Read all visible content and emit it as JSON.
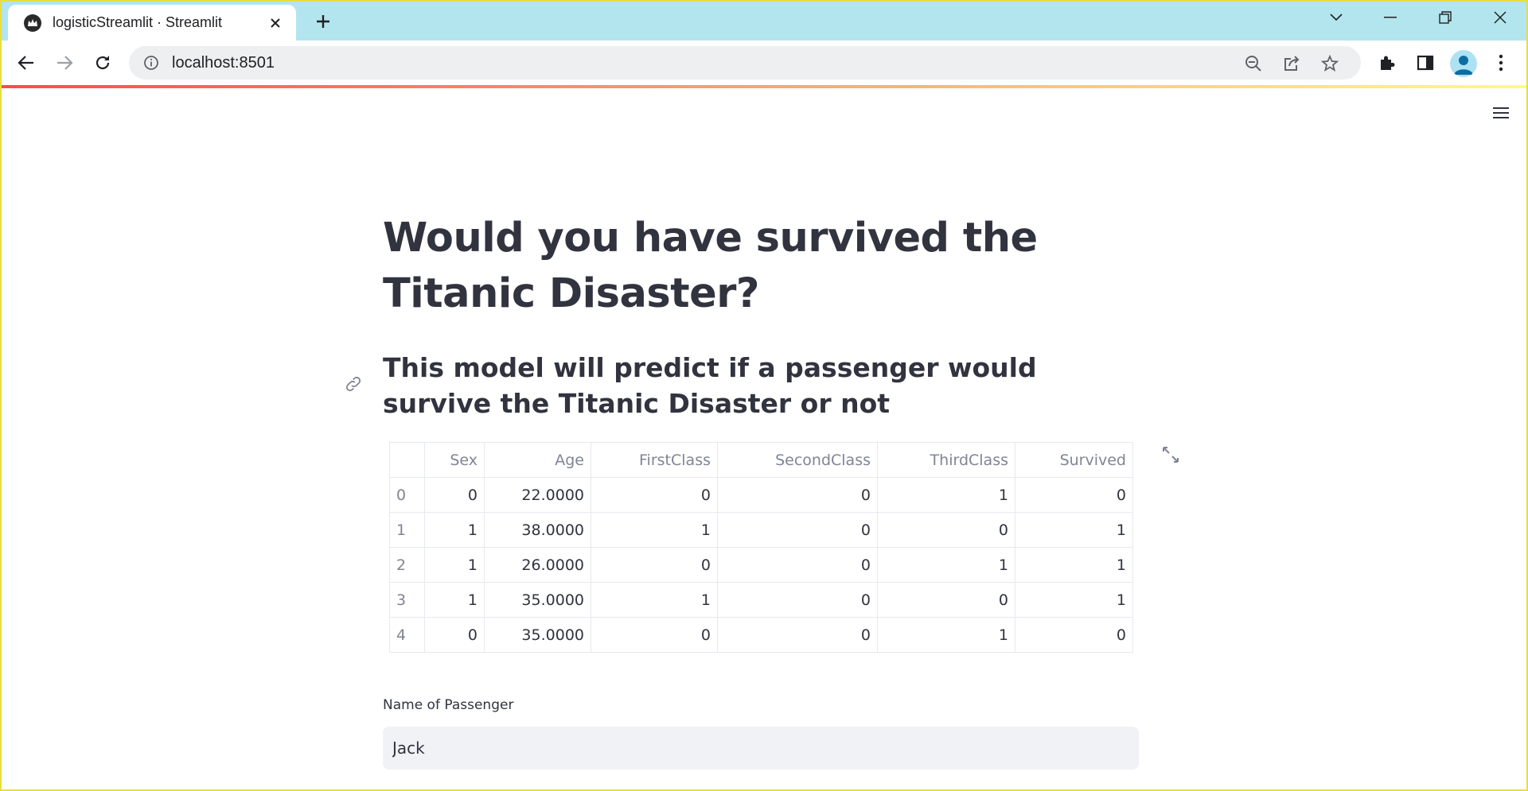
{
  "browser": {
    "tab_title": "logisticStreamlit · Streamlit",
    "url": "localhost:8501"
  },
  "page": {
    "title": "Would you have survived the Titanic Disaster?",
    "subtitle": "This model will predict if a passenger would survive the Titanic Disaster or not"
  },
  "table": {
    "columns": [
      "",
      "Sex",
      "Age",
      "FirstClass",
      "SecondClass",
      "ThirdClass",
      "Survived"
    ],
    "rows": [
      [
        "0",
        "0",
        "22.0000",
        "0",
        "0",
        "1",
        "0"
      ],
      [
        "1",
        "1",
        "38.0000",
        "1",
        "0",
        "0",
        "1"
      ],
      [
        "2",
        "1",
        "26.0000",
        "0",
        "0",
        "1",
        "1"
      ],
      [
        "3",
        "1",
        "35.0000",
        "1",
        "0",
        "0",
        "1"
      ],
      [
        "4",
        "0",
        "35.0000",
        "0",
        "0",
        "1",
        "0"
      ]
    ]
  },
  "form": {
    "name_label": "Name of Passenger",
    "name_value": "Jack"
  },
  "colors": {
    "tabstrip": "#b3e5ee",
    "text": "#31333f",
    "accent_bar_start": "#ff4b4b",
    "accent_bar_end": "#fffd80"
  }
}
